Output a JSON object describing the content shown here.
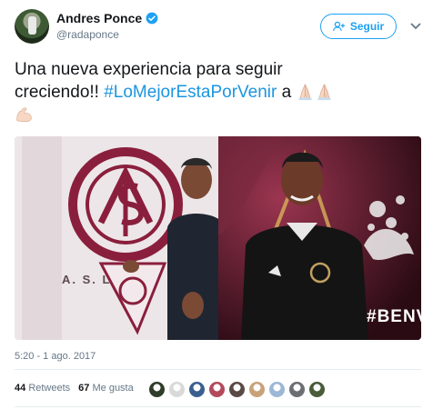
{
  "author": {
    "name": "Andres Ponce",
    "handle": "@radaponce"
  },
  "follow_label": "Seguir",
  "tweet": {
    "line1": "Una nueva experiencia para seguir",
    "line2_prefix": "creciendo!! ",
    "hashtag": "#LoMejorEstaPorVenir",
    "line2_suffix": " a "
  },
  "media": {
    "crest_text": "A. S. L",
    "overlay_text": "#BENV"
  },
  "timestamp": "5:20 - 1 ago. 2017",
  "stats": {
    "retweets_count": "44",
    "retweets_label": "Retweets",
    "likes_count": "67",
    "likes_label": "Me gusta"
  },
  "liker_colors": [
    "#2f3d2a",
    "#d9d9d9",
    "#3b5f8f",
    "#b34a5c",
    "#5a4a45",
    "#c9a27a",
    "#9db7d6",
    "#6b6e72",
    "#4a5c3a"
  ],
  "colors": {
    "accent": "#1da1f2",
    "hashtag": "#1b95e0",
    "muted": "#657786",
    "club": "#8a1f3d"
  }
}
